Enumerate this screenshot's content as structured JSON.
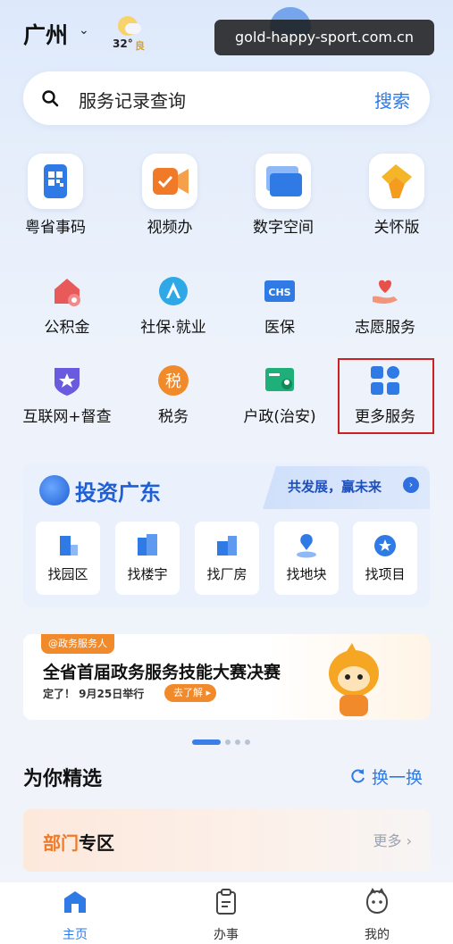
{
  "header": {
    "city": "广州",
    "temperature": "32°",
    "air_quality": "良"
  },
  "watermark": "gold-happy-sport.com.cn",
  "search": {
    "placeholder": "服务记录查询",
    "button": "搜索"
  },
  "top_services": [
    {
      "label": "粤省事码",
      "icon": "qr-code-icon"
    },
    {
      "label": "视频办",
      "icon": "video-icon"
    },
    {
      "label": "数字空间",
      "icon": "folder-icon"
    },
    {
      "label": "关怀版",
      "icon": "care-icon"
    }
  ],
  "services_row2": [
    {
      "label": "公积金",
      "icon": "house-fund-icon"
    },
    {
      "label": "社保·就业",
      "icon": "social-security-icon"
    },
    {
      "label": "医保",
      "icon": "medical-insurance-icon",
      "badge": "CHS"
    },
    {
      "label": "志愿服务",
      "icon": "volunteer-icon"
    }
  ],
  "services_row3": [
    {
      "label": "互联网+督查",
      "icon": "shield-star-icon"
    },
    {
      "label": "税务",
      "icon": "tax-icon",
      "glyph": "税"
    },
    {
      "label": "户政(治安)",
      "icon": "id-card-icon"
    },
    {
      "label": "更多服务",
      "icon": "more-grid-icon"
    }
  ],
  "invest": {
    "title": "投资广东",
    "tagline": "共发展，赢未来",
    "items": [
      {
        "label": "找园区",
        "icon": "park-icon"
      },
      {
        "label": "找楼宇",
        "icon": "building-icon"
      },
      {
        "label": "找厂房",
        "icon": "factory-icon"
      },
      {
        "label": "找地块",
        "icon": "land-icon"
      },
      {
        "label": "找项目",
        "icon": "project-icon"
      }
    ]
  },
  "banner": {
    "tag": "@政务服务人",
    "title": "全省首届政务服务技能大赛决赛",
    "subtitle": "定了！ 9月25日举行",
    "button": "去了解"
  },
  "featured": {
    "title": "为你精选",
    "refresh": "换一换"
  },
  "department": {
    "title_part1": "部门",
    "title_part2": "专区",
    "more": "更多"
  },
  "tabs": [
    {
      "label": "主页",
      "icon": "home-icon",
      "active": true
    },
    {
      "label": "办事",
      "icon": "clipboard-icon",
      "active": false
    },
    {
      "label": "我的",
      "icon": "profile-mascot-icon",
      "active": false
    }
  ],
  "colors": {
    "accent": "#2f7ae5",
    "highlight_border": "#cf2020",
    "orange": "#f08a2a"
  }
}
